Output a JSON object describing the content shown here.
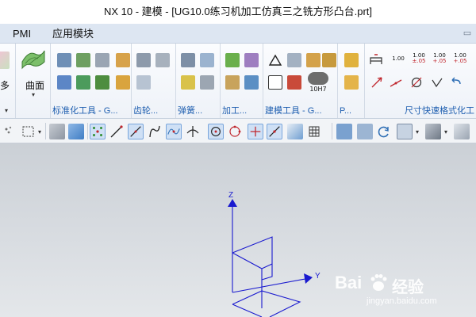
{
  "window": {
    "title": "NX 10 - 建模 - [UG10.0练习机加工仿真三之铣方形凸台.prt]"
  },
  "menu": {
    "items": [
      "PMI",
      "应用模块"
    ]
  },
  "ribbon": {
    "groups": [
      {
        "label": "标准化工具 - G..."
      },
      {
        "label": "齿轮..."
      },
      {
        "label": "弹簧..."
      },
      {
        "label": "加工..."
      },
      {
        "label": "建模工具 - G..."
      },
      {
        "label": "P..."
      },
      {
        "label": "尺寸快速格式化工"
      }
    ],
    "big_buttons": {
      "left_partial": "多",
      "surface": "曲面"
    },
    "fit_label": "10H7",
    "tolerances": [
      {
        "top": "1.00",
        "bottom": ""
      },
      {
        "top": "1.00",
        "bottom": "±.05"
      },
      {
        "top": "1.00",
        "bottom": "+.05"
      },
      {
        "top": "1.00",
        "bottom": "+.05"
      }
    ]
  },
  "viewport": {
    "axes": {
      "z": "Z",
      "y": "Y"
    },
    "watermark": {
      "brand": "Bai",
      "brand2": "经验",
      "url": "jingyan.baidu.com"
    }
  },
  "colors": {
    "accent": "#1f5fb0",
    "axis": "#1a1acf",
    "menu_bg": "#dde6f2",
    "viewport_top": "#cbd0d6",
    "viewport_bottom": "#e4e7ea"
  }
}
